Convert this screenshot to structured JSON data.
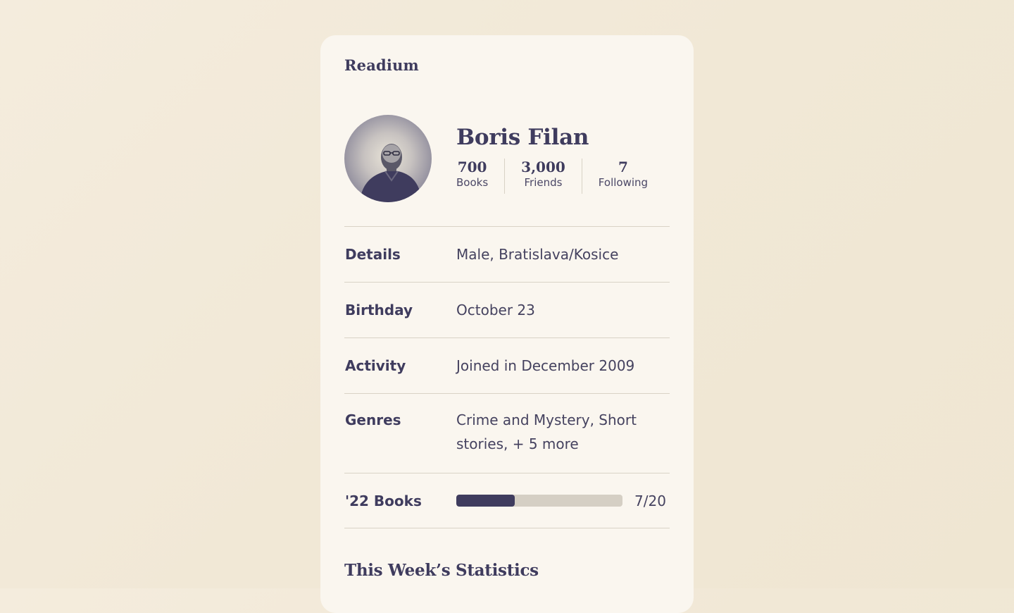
{
  "app": {
    "brand": "Readium"
  },
  "profile": {
    "name": "Boris Filan",
    "avatar_icon": "user-portrait",
    "stats": [
      {
        "value": "700",
        "label": "Books"
      },
      {
        "value": "3,000",
        "label": "Friends"
      },
      {
        "value": "7",
        "label": "Following"
      }
    ]
  },
  "details": {
    "rows": [
      {
        "key": "Details",
        "value": "Male, Bratislava/Kosice"
      },
      {
        "key": "Birthday",
        "value": "October 23"
      },
      {
        "key": "Activity",
        "value": "Joined in December 2009"
      },
      {
        "key": "Genres",
        "value": "Crime and Mystery, Short stories, + 5 more"
      }
    ],
    "reading_goal": {
      "key": "'22 Books",
      "progress_text": "7/20",
      "progress_fraction": 0.35
    }
  },
  "section": {
    "title": "This Week’s Statistics"
  },
  "colors": {
    "page_bg": "#f2e9d8",
    "card_bg": "#faf6ef",
    "ink": "#3f3c5e",
    "divider": "#d9d3c6",
    "progress_track": "#d5cfc4",
    "progress_fill": "#3f3c5e"
  }
}
